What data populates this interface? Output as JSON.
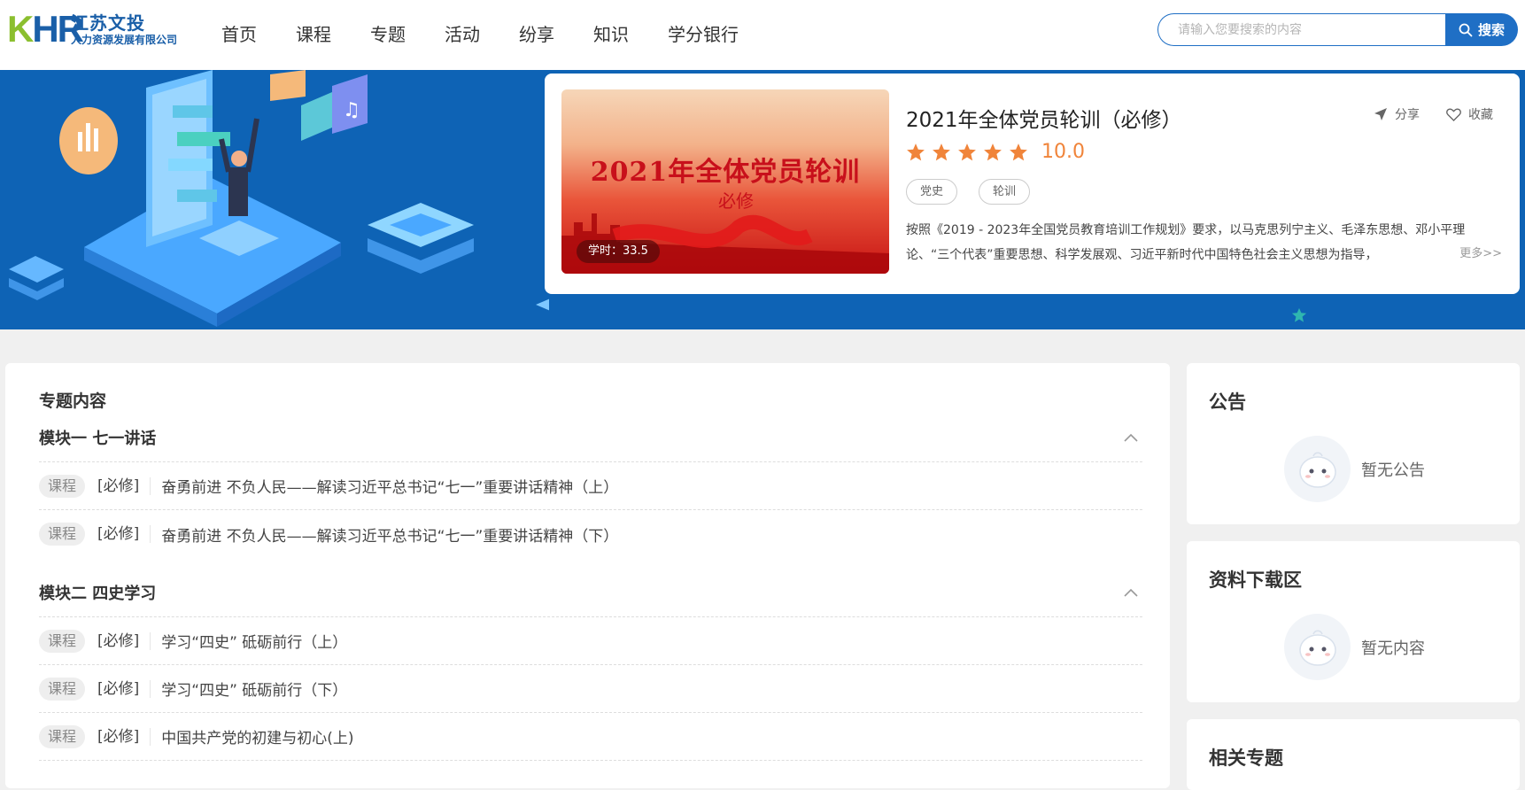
{
  "header": {
    "logo": {
      "mark": "KHR",
      "name": "江苏文投",
      "company": "人力资源发展有限公司"
    },
    "nav": [
      "首页",
      "课程",
      "专题",
      "活动",
      "纷享",
      "知识",
      "学分银行"
    ],
    "search": {
      "placeholder": "请输入您要搜索的内容",
      "value": "",
      "button": "搜索"
    }
  },
  "course": {
    "cover_title": "2021年全体党员轮训",
    "cover_subtitle": "必修",
    "hours": "学时：33.5",
    "title": "2021年全体党员轮训（必修）",
    "share": "分享",
    "favorite": "收藏",
    "stars": 5,
    "rating": "10.0",
    "tags": [
      "党史",
      "轮训"
    ],
    "description": "按照《2019 - 2023年全国党员教育培训工作规划》要求，以马克思列宁主义、毛泽东思想、邓小平理论、“三个代表”重要思想、科学发展观、习近平新时代中国特色社会主义思想为指导，",
    "more": "更多>>"
  },
  "topic": {
    "title": "专题内容",
    "modules": [
      {
        "name": "模块一 七一讲话",
        "items": [
          {
            "type": "课程",
            "required": "[必修]",
            "title": "奋勇前进 不负人民——解读习近平总书记“七一”重要讲话精神（上）"
          },
          {
            "type": "课程",
            "required": "[必修]",
            "title": "奋勇前进 不负人民——解读习近平总书记“七一”重要讲话精神（下）"
          }
        ]
      },
      {
        "name": "模块二 四史学习",
        "items": [
          {
            "type": "课程",
            "required": "[必修]",
            "title": "学习“四史” 砥砺前行（上）"
          },
          {
            "type": "课程",
            "required": "[必修]",
            "title": "学习“四史” 砥砺前行（下）"
          },
          {
            "type": "课程",
            "required": "[必修]",
            "title": "中国共产党的初建与初心(上)"
          }
        ]
      }
    ]
  },
  "sidebar": {
    "notice": {
      "title": "公告",
      "empty": "暂无公告"
    },
    "downloads": {
      "title": "资料下载区",
      "empty": "暂无内容"
    },
    "related": {
      "title": "相关专题"
    }
  },
  "colors": {
    "primary": "#1f6fc5",
    "banner": "#0e63b5",
    "star": "#f0843a"
  }
}
